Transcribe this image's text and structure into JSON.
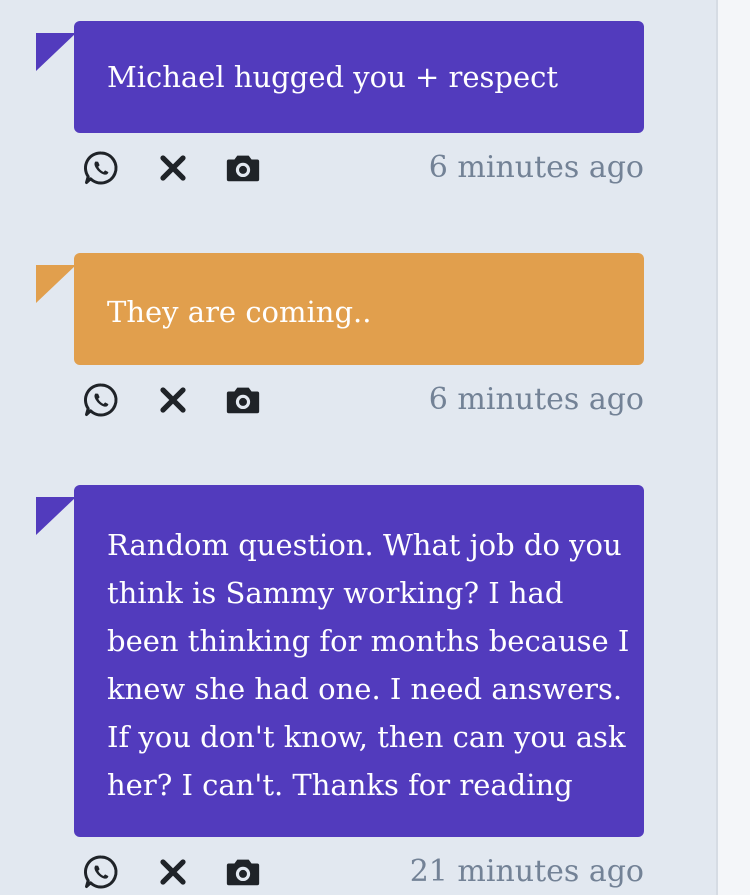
{
  "colors": {
    "purple": "#523bbd",
    "orange": "#e19f4d",
    "background": "#e2e8f0",
    "timestamp": "#738296"
  },
  "messages": [
    {
      "text": "Michael hugged you + respect",
      "color": "purple",
      "time": "6 minutes ago",
      "icons": [
        "whatsapp-icon",
        "close-icon",
        "camera-icon"
      ]
    },
    {
      "text": "They are coming..",
      "color": "orange",
      "time": "6 minutes ago",
      "icons": [
        "whatsapp-icon",
        "close-icon",
        "camera-icon"
      ]
    },
    {
      "lines": [
        "Random question. What job do you",
        "think is Sammy working? I had",
        "been thinking for months because I",
        "knew she had one. I need answers.",
        "If you don't know, then can you ask",
        "her? I can't. Thanks for reading"
      ],
      "color": "purple",
      "time": "21 minutes ago",
      "icons": [
        "whatsapp-icon",
        "close-icon",
        "camera-icon"
      ]
    }
  ]
}
